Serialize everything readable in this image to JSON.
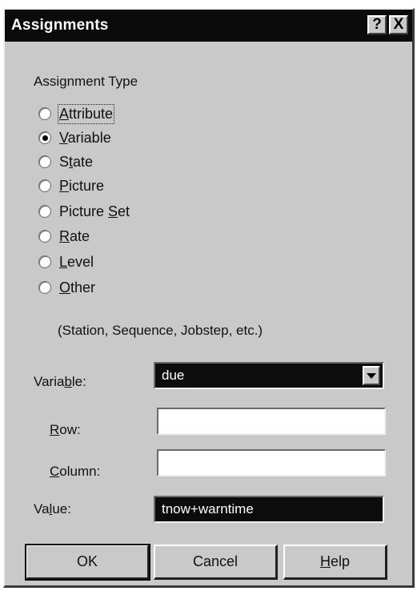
{
  "window": {
    "title": "Assignments",
    "help_button": "?",
    "close_button": "X"
  },
  "assignment_type": {
    "label": "Assignment Type",
    "selected": "Variable",
    "options": [
      {
        "pre": "",
        "key": "A",
        "post": "ttribute"
      },
      {
        "pre": "",
        "key": "V",
        "post": "ariable"
      },
      {
        "pre": "S",
        "key": "t",
        "post": "ate"
      },
      {
        "pre": "",
        "key": "P",
        "post": "icture"
      },
      {
        "pre": "Picture ",
        "key": "S",
        "post": "et"
      },
      {
        "pre": "",
        "key": "R",
        "post": "ate"
      },
      {
        "pre": "",
        "key": "L",
        "post": "evel"
      },
      {
        "pre": "",
        "key": "O",
        "post": "ther"
      }
    ],
    "other_note": "(Station, Sequence, Jobstep, etc.)"
  },
  "fields": {
    "variable": {
      "pre": "Varia",
      "key": "b",
      "post": "le:",
      "value": "due"
    },
    "row": {
      "pre": "",
      "key": "R",
      "post": "ow:",
      "value": ""
    },
    "column": {
      "pre": "",
      "key": "C",
      "post": "olumn:",
      "value": ""
    },
    "value": {
      "pre": "Va",
      "key": "l",
      "post": "ue:",
      "value": "tnow+warntime"
    }
  },
  "buttons": {
    "ok": "OK",
    "cancel": "Cancel",
    "help": {
      "pre": "",
      "key": "H",
      "post": "elp"
    }
  }
}
